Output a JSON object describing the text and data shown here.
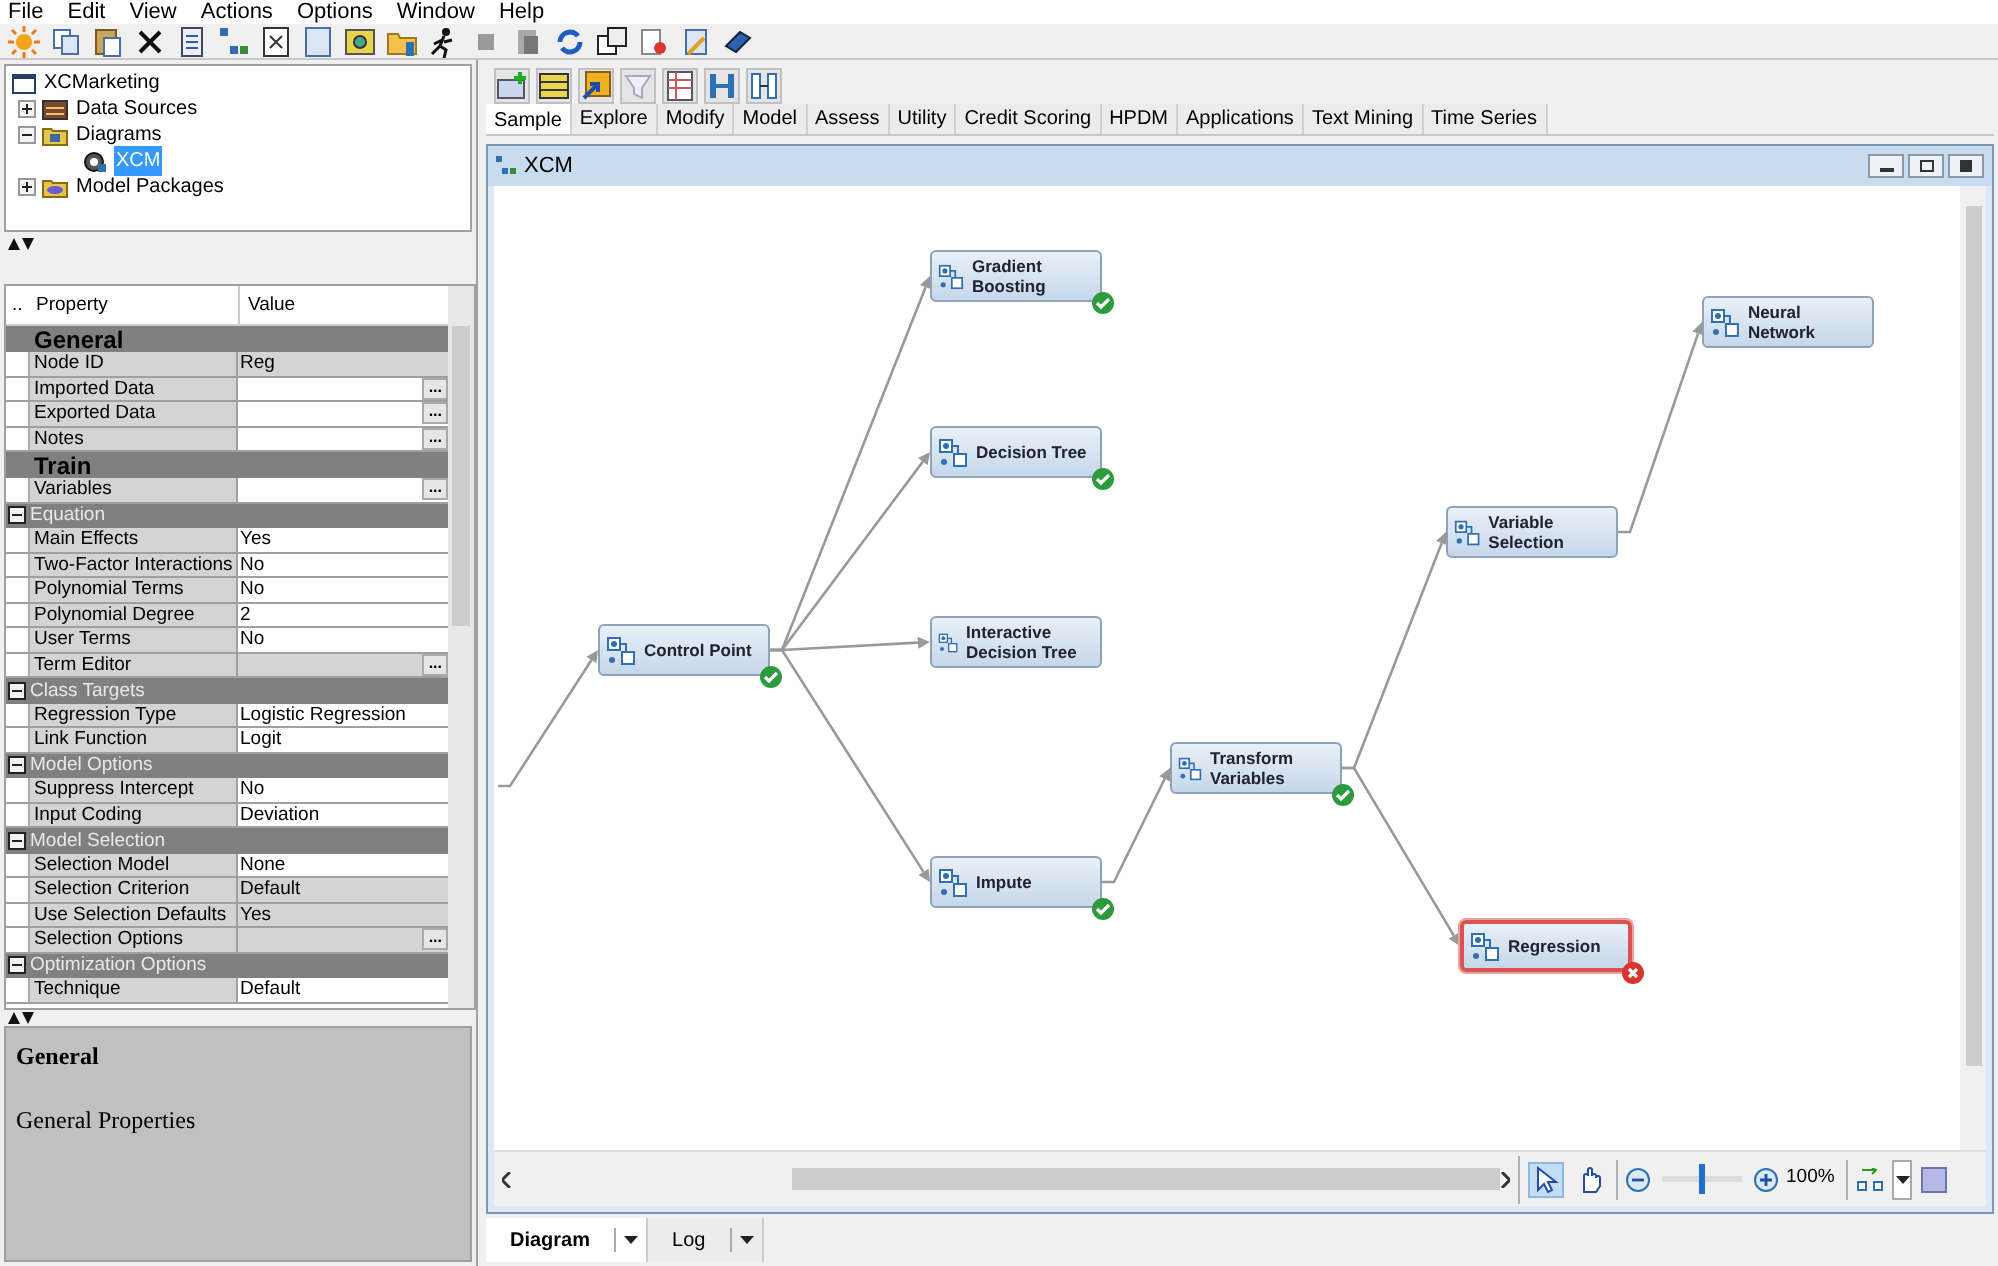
{
  "menu": [
    "File",
    "Edit",
    "View",
    "Actions",
    "Options",
    "Window",
    "Help"
  ],
  "project_tree": {
    "label": "XCMarketing",
    "children": [
      {
        "label": "Data Sources",
        "expanded": false,
        "selected": false,
        "kind": "datasource"
      },
      {
        "label": "Diagrams",
        "expanded": true,
        "selected": false,
        "kind": "folder",
        "children": [
          {
            "label": "XCM",
            "selected": true,
            "kind": "diagram"
          }
        ]
      },
      {
        "label": "Model Packages",
        "expanded": false,
        "selected": false,
        "kind": "package"
      }
    ]
  },
  "properties": {
    "columns": [
      "..",
      "Property",
      "Value"
    ],
    "groups": [
      {
        "kind": "category",
        "label": "General",
        "rows": [
          {
            "name": "Node ID",
            "value": "Reg",
            "editable": false,
            "button": null
          },
          {
            "name": "Imported Data",
            "value": "",
            "editable": true,
            "button": "..."
          },
          {
            "name": "Exported Data",
            "value": "",
            "editable": true,
            "button": "..."
          },
          {
            "name": "Notes",
            "value": "",
            "editable": true,
            "button": "..."
          }
        ]
      },
      {
        "kind": "category",
        "label": "Train",
        "rows": [
          {
            "name": "Variables",
            "value": "",
            "editable": true,
            "button": "..."
          }
        ]
      },
      {
        "kind": "subgroup",
        "label": "Equation",
        "expanded": true,
        "rows": [
          {
            "name": "Main Effects",
            "value": "Yes",
            "editable": true,
            "button": null
          },
          {
            "name": "Two-Factor Interactions",
            "value": "No",
            "editable": true,
            "button": null
          },
          {
            "name": "Polynomial Terms",
            "value": "No",
            "editable": true,
            "button": null
          },
          {
            "name": "Polynomial Degree",
            "value": "2",
            "editable": true,
            "button": null
          },
          {
            "name": "User Terms",
            "value": "No",
            "editable": true,
            "button": null
          },
          {
            "name": "Term Editor",
            "value": "",
            "editable": false,
            "button": "..."
          }
        ]
      },
      {
        "kind": "subgroup",
        "label": "Class Targets",
        "expanded": true,
        "rows": [
          {
            "name": "Regression Type",
            "value": "Logistic Regression",
            "editable": true,
            "button": null
          },
          {
            "name": "Link Function",
            "value": "Logit",
            "editable": true,
            "button": null
          }
        ]
      },
      {
        "kind": "subgroup",
        "label": "Model Options",
        "expanded": true,
        "rows": [
          {
            "name": "Suppress Intercept",
            "value": "No",
            "editable": true,
            "button": null
          },
          {
            "name": "Input Coding",
            "value": "Deviation",
            "editable": true,
            "button": null
          }
        ]
      },
      {
        "kind": "subgroup",
        "label": "Model Selection",
        "expanded": true,
        "rows": [
          {
            "name": "Selection Model",
            "value": "None",
            "editable": true,
            "button": null
          },
          {
            "name": "Selection Criterion",
            "value": "Default",
            "editable": false,
            "button": null
          },
          {
            "name": "Use Selection Defaults",
            "value": "Yes",
            "editable": false,
            "button": null
          },
          {
            "name": "Selection Options",
            "value": "",
            "editable": false,
            "button": "..."
          }
        ]
      },
      {
        "kind": "subgroup",
        "label": "Optimization Options",
        "expanded": true,
        "rows": [
          {
            "name": "Technique",
            "value": "Default",
            "editable": true,
            "button": null
          }
        ]
      }
    ]
  },
  "description": {
    "title": "General",
    "text": "General Properties"
  },
  "tool_tabs": [
    {
      "label": "Sample",
      "selected": true
    },
    {
      "label": "Explore",
      "selected": false
    },
    {
      "label": "Modify",
      "selected": false
    },
    {
      "label": "Model",
      "selected": false
    },
    {
      "label": "Assess",
      "selected": false
    },
    {
      "label": "Utility",
      "selected": false
    },
    {
      "label": "Credit Scoring",
      "selected": false
    },
    {
      "label": "HPDM",
      "selected": false
    },
    {
      "label": "Applications",
      "selected": false
    },
    {
      "label": "Text Mining",
      "selected": false
    },
    {
      "label": "Time Series",
      "selected": false
    }
  ],
  "diagram": {
    "title": "XCM",
    "nodes": [
      {
        "label": "Control Point",
        "completed": true,
        "failed": false,
        "selected": false
      },
      {
        "label": "Gradient Boosting",
        "completed": true,
        "failed": false,
        "selected": false
      },
      {
        "label": "Decision Tree",
        "completed": true,
        "failed": false,
        "selected": false
      },
      {
        "label": "Interactive Decision Tree",
        "completed": false,
        "failed": false,
        "selected": false
      },
      {
        "label": "Impute",
        "completed": true,
        "failed": false,
        "selected": false
      },
      {
        "label": "Transform Variables",
        "completed": true,
        "failed": false,
        "selected": false
      },
      {
        "label": "Variable Selection",
        "completed": false,
        "failed": false,
        "selected": false
      },
      {
        "label": "Neural Network",
        "completed": false,
        "failed": false,
        "selected": false
      },
      {
        "label": "Regression",
        "completed": false,
        "failed": true,
        "selected": true
      }
    ],
    "tools": [
      {
        "kind": "pointer",
        "selected": true
      },
      {
        "kind": "hand",
        "selected": false
      }
    ],
    "zoom": {
      "level": 0.5,
      "reading": "100%"
    }
  },
  "bottom_tabs": [
    {
      "label": "Diagram",
      "selected": true
    },
    {
      "label": "Log",
      "selected": false
    }
  ]
}
